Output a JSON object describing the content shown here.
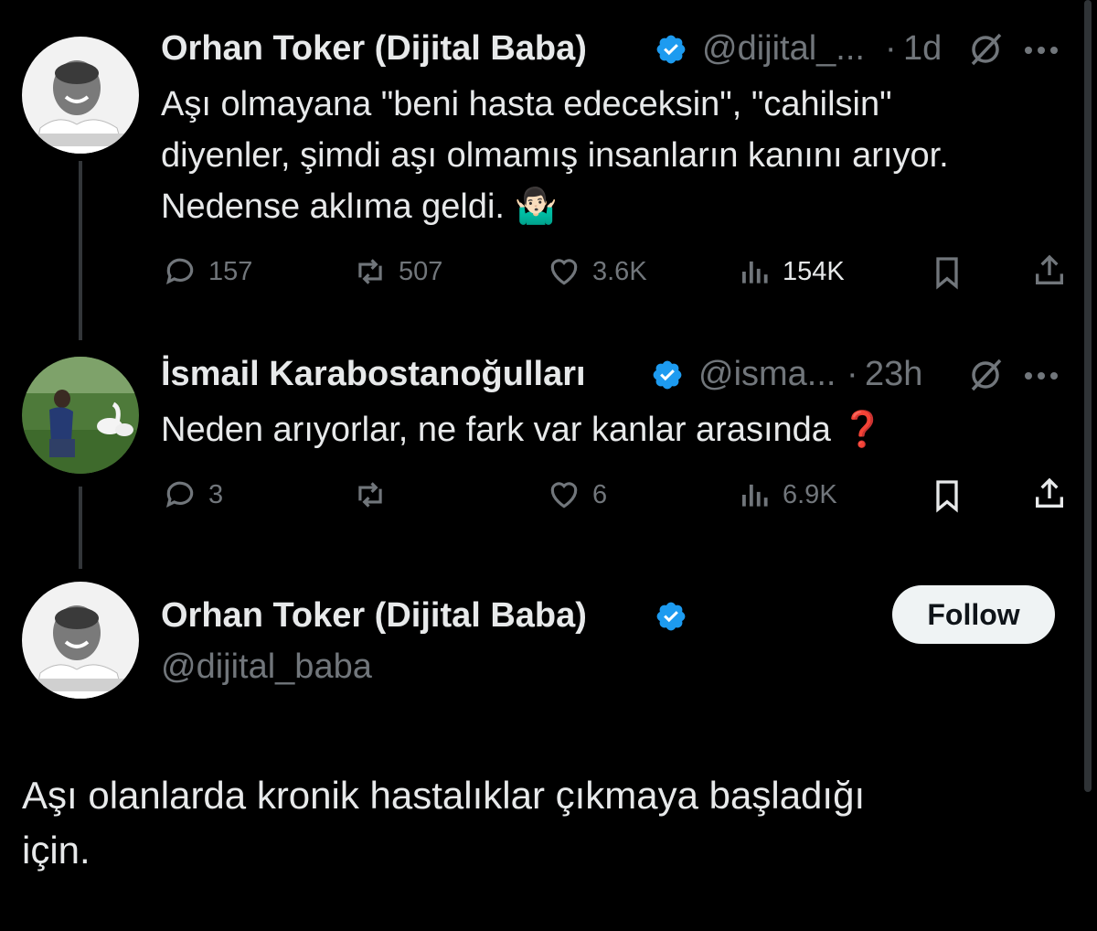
{
  "tweets": [
    {
      "name": "Orhan Toker (Dijital Baba)",
      "handle": "@dijital_...",
      "time": "1d",
      "meta_sep": "·",
      "lines": [
        "Aşı olmayana \"beni hasta edeceksin\", \"cahilsin\"",
        "diyenler, şimdi aşı olmamış insanların kanını arıyor.",
        "Nedense aklıma geldi. 🤷🏻‍♂️"
      ],
      "replies": "157",
      "reposts": "507",
      "likes": "3.6K",
      "views": "154K"
    },
    {
      "name": "İsmail Karabostanoğulları",
      "handle": "@isma...",
      "time": "23h",
      "meta_sep": "·",
      "text": "Neden arıyorlar, ne fark var kanlar arasında ",
      "text_emoji": "❓",
      "replies": "3",
      "reposts": "",
      "likes": "6",
      "views": "6.9K"
    }
  ],
  "main": {
    "name": "Orhan Toker (Dijital Baba)",
    "handle": "@dijital_baba",
    "follow_label": "Follow",
    "lines": [
      "Aşı olanlarda kronik hastalıklar çıkmaya başladığı",
      "için."
    ]
  },
  "colors": {
    "verified": "#1d9bf0",
    "muted": "#71767b",
    "text": "#e7e9ea",
    "bg": "#000000"
  }
}
